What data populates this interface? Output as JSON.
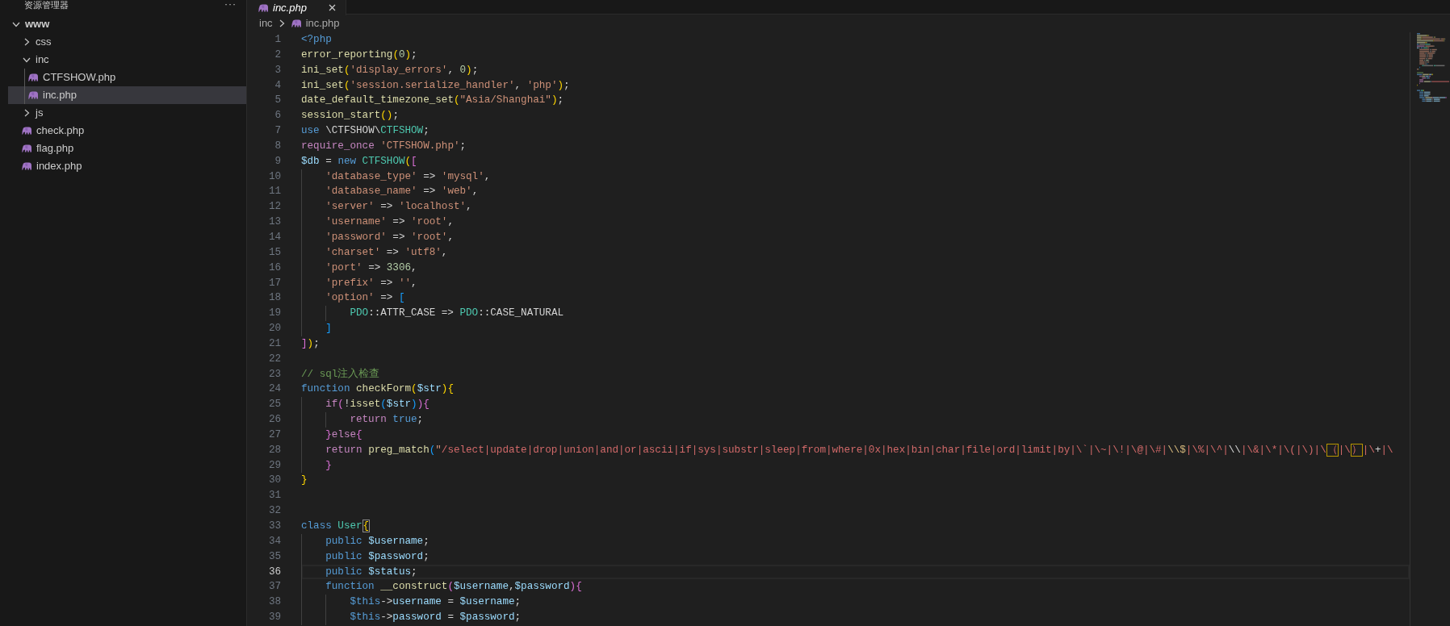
{
  "explorer": {
    "title": "资源管理器",
    "more": "···",
    "tree": [
      {
        "label": "www",
        "kind": "folder",
        "expanded": true,
        "selected": false,
        "children": [
          {
            "label": "css",
            "kind": "folder",
            "expanded": false,
            "selected": false
          },
          {
            "label": "inc",
            "kind": "folder",
            "expanded": true,
            "selected": false,
            "children": [
              {
                "label": "CTFSHOW.php",
                "kind": "php",
                "selected": false
              },
              {
                "label": "inc.php",
                "kind": "php",
                "selected": true
              }
            ]
          },
          {
            "label": "js",
            "kind": "folder",
            "expanded": false,
            "selected": false
          },
          {
            "label": "check.php",
            "kind": "php",
            "selected": false
          },
          {
            "label": "flag.php",
            "kind": "php",
            "selected": false
          },
          {
            "label": "index.php",
            "kind": "php",
            "selected": false
          }
        ]
      }
    ]
  },
  "tabs": [
    {
      "label": "inc.php",
      "kind": "php",
      "selected": true,
      "preview": true
    }
  ],
  "breadcrumb": [
    {
      "label": "inc",
      "kind": "folder"
    },
    {
      "label": "inc.php",
      "kind": "php"
    }
  ],
  "editor": {
    "lines": [
      {
        "number": "1",
        "current": false,
        "tokens": [
          {
            "kind": "keyword",
            "text": "<?php"
          }
        ]
      },
      {
        "number": "2",
        "current": false,
        "tokens": [
          {
            "kind": "function",
            "text": "error_reporting"
          },
          {
            "kind": "bracket1",
            "text": "("
          },
          {
            "kind": "number",
            "text": "0"
          },
          {
            "kind": "bracket1",
            "text": ")"
          },
          {
            "kind": "plain",
            "text": ";"
          }
        ]
      },
      {
        "number": "3",
        "current": false,
        "tokens": [
          {
            "kind": "function",
            "text": "ini_set"
          },
          {
            "kind": "bracket1",
            "text": "("
          },
          {
            "kind": "string",
            "text": "'display_errors'"
          },
          {
            "kind": "plain",
            "text": ", "
          },
          {
            "kind": "number",
            "text": "0"
          },
          {
            "kind": "bracket1",
            "text": ")"
          },
          {
            "kind": "plain",
            "text": ";"
          }
        ]
      },
      {
        "number": "4",
        "current": false,
        "tokens": [
          {
            "kind": "function",
            "text": "ini_set"
          },
          {
            "kind": "bracket1",
            "text": "("
          },
          {
            "kind": "string",
            "text": "'session.serialize_handler'"
          },
          {
            "kind": "plain",
            "text": ", "
          },
          {
            "kind": "string",
            "text": "'php'"
          },
          {
            "kind": "bracket1",
            "text": ")"
          },
          {
            "kind": "plain",
            "text": ";"
          }
        ]
      },
      {
        "number": "5",
        "current": false,
        "tokens": [
          {
            "kind": "function",
            "text": "date_default_timezone_set"
          },
          {
            "kind": "bracket1",
            "text": "("
          },
          {
            "kind": "string",
            "text": "\"Asia/Shanghai\""
          },
          {
            "kind": "bracket1",
            "text": ")"
          },
          {
            "kind": "plain",
            "text": ";"
          }
        ]
      },
      {
        "number": "6",
        "current": false,
        "tokens": [
          {
            "kind": "function",
            "text": "session_start"
          },
          {
            "kind": "bracket1",
            "text": "("
          },
          {
            "kind": "bracket1",
            "text": ")"
          },
          {
            "kind": "plain",
            "text": ";"
          }
        ]
      },
      {
        "number": "7",
        "current": false,
        "tokens": [
          {
            "kind": "keyword",
            "text": "use"
          },
          {
            "kind": "plain",
            "text": " \\CTFSHOW\\"
          },
          {
            "kind": "type",
            "text": "CTFSHOW"
          },
          {
            "kind": "plain",
            "text": ";"
          }
        ]
      },
      {
        "number": "8",
        "current": false,
        "tokens": [
          {
            "kind": "control",
            "text": "require_once "
          },
          {
            "kind": "string",
            "text": "'CTFSHOW.php'"
          },
          {
            "kind": "plain",
            "text": ";"
          }
        ]
      },
      {
        "number": "9",
        "current": false,
        "tokens": [
          {
            "kind": "variable",
            "text": "$db"
          },
          {
            "kind": "plain",
            "text": " = "
          },
          {
            "kind": "keyword",
            "text": "new "
          },
          {
            "kind": "type",
            "text": "CTFSHOW"
          },
          {
            "kind": "bracket1",
            "text": "("
          },
          {
            "kind": "bracket2",
            "text": "["
          }
        ]
      },
      {
        "number": "10",
        "current": false,
        "tokens": [
          {
            "kind": "string",
            "text": "    'database_type'"
          },
          {
            "kind": "plain",
            "text": " => "
          },
          {
            "kind": "string",
            "text": "'mysql'"
          },
          {
            "kind": "plain",
            "text": ","
          }
        ]
      },
      {
        "number": "11",
        "current": false,
        "tokens": [
          {
            "kind": "string",
            "text": "    'database_name'"
          },
          {
            "kind": "plain",
            "text": " => "
          },
          {
            "kind": "string",
            "text": "'web'"
          },
          {
            "kind": "plain",
            "text": ","
          }
        ]
      },
      {
        "number": "12",
        "current": false,
        "tokens": [
          {
            "kind": "string",
            "text": "    'server'"
          },
          {
            "kind": "plain",
            "text": " => "
          },
          {
            "kind": "string",
            "text": "'localhost'"
          },
          {
            "kind": "plain",
            "text": ","
          }
        ]
      },
      {
        "number": "13",
        "current": false,
        "tokens": [
          {
            "kind": "string",
            "text": "    'username'"
          },
          {
            "kind": "plain",
            "text": " => "
          },
          {
            "kind": "string",
            "text": "'root'"
          },
          {
            "kind": "plain",
            "text": ","
          }
        ]
      },
      {
        "number": "14",
        "current": false,
        "tokens": [
          {
            "kind": "string",
            "text": "    'password'"
          },
          {
            "kind": "plain",
            "text": " => "
          },
          {
            "kind": "string",
            "text": "'root'"
          },
          {
            "kind": "plain",
            "text": ","
          }
        ]
      },
      {
        "number": "15",
        "current": false,
        "tokens": [
          {
            "kind": "string",
            "text": "    'charset'"
          },
          {
            "kind": "plain",
            "text": " => "
          },
          {
            "kind": "string",
            "text": "'utf8'"
          },
          {
            "kind": "plain",
            "text": ","
          }
        ]
      },
      {
        "number": "16",
        "current": false,
        "tokens": [
          {
            "kind": "string",
            "text": "    'port'"
          },
          {
            "kind": "plain",
            "text": " => "
          },
          {
            "kind": "number",
            "text": "3306"
          },
          {
            "kind": "plain",
            "text": ","
          }
        ]
      },
      {
        "number": "17",
        "current": false,
        "tokens": [
          {
            "kind": "string",
            "text": "    'prefix'"
          },
          {
            "kind": "plain",
            "text": " => "
          },
          {
            "kind": "string",
            "text": "''"
          },
          {
            "kind": "plain",
            "text": ","
          }
        ]
      },
      {
        "number": "18",
        "current": false,
        "tokens": [
          {
            "kind": "string",
            "text": "    'option'"
          },
          {
            "kind": "plain",
            "text": " => "
          },
          {
            "kind": "bracket3",
            "text": "["
          }
        ]
      },
      {
        "number": "19",
        "current": false,
        "tokens": [
          {
            "kind": "type",
            "text": "        PDO"
          },
          {
            "kind": "plain",
            "text": "::ATTR_CASE => "
          },
          {
            "kind": "type",
            "text": "PDO"
          },
          {
            "kind": "plain",
            "text": "::CASE_NATURAL"
          }
        ]
      },
      {
        "number": "20",
        "current": false,
        "tokens": [
          {
            "kind": "bracket3",
            "text": "    ]"
          }
        ]
      },
      {
        "number": "21",
        "current": false,
        "tokens": [
          {
            "kind": "bracket2",
            "text": "]"
          },
          {
            "kind": "bracket1",
            "text": ")"
          },
          {
            "kind": "plain",
            "text": ";"
          }
        ]
      },
      {
        "number": "22",
        "current": false
      },
      {
        "number": "23",
        "current": false,
        "tokens": [
          {
            "kind": "comment",
            "text": "// sql注入检查"
          }
        ]
      },
      {
        "number": "24",
        "current": false,
        "tokens": [
          {
            "kind": "keyword",
            "text": "function "
          },
          {
            "kind": "function",
            "text": "checkForm"
          },
          {
            "kind": "bracket1",
            "text": "("
          },
          {
            "kind": "variable",
            "text": "$str"
          },
          {
            "kind": "bracket1",
            "text": ")"
          },
          {
            "kind": "bracket1",
            "text": "{"
          }
        ]
      },
      {
        "number": "25",
        "current": false,
        "tokens": [
          {
            "kind": "control",
            "text": "    if"
          },
          {
            "kind": "bracket2",
            "text": "("
          },
          {
            "kind": "plain",
            "text": "!"
          },
          {
            "kind": "function",
            "text": "isset"
          },
          {
            "kind": "bracket3",
            "text": "("
          },
          {
            "kind": "variable",
            "text": "$str"
          },
          {
            "kind": "bracket3",
            "text": ")"
          },
          {
            "kind": "bracket2",
            "text": ")"
          },
          {
            "kind": "bracket2",
            "text": "{"
          }
        ]
      },
      {
        "number": "26",
        "current": false,
        "tokens": [
          {
            "kind": "control",
            "text": "        return "
          },
          {
            "kind": "keyword",
            "text": "true"
          },
          {
            "kind": "plain",
            "text": ";"
          }
        ]
      },
      {
        "number": "27",
        "current": false,
        "tokens": [
          {
            "kind": "bracket2",
            "text": "    }"
          },
          {
            "kind": "control",
            "text": "else"
          },
          {
            "kind": "bracket2",
            "text": "{"
          }
        ]
      },
      {
        "number": "28",
        "current": false,
        "tokens": [
          {
            "kind": "control",
            "text": "    return "
          },
          {
            "kind": "function",
            "text": "preg_match"
          },
          {
            "kind": "bracket3",
            "text": "("
          },
          {
            "kind": "string",
            "text": "\""
          },
          {
            "kind": "regex",
            "text": "/select|update|drop|union|and|or|ascii|if|sys|substr|sleep|from|where|0x|hex|bin|char|file|ord|limit|by|\\`|\\~|\\!|\\@|\\#|"
          },
          {
            "kind": "escape",
            "text": "\\\\$"
          },
          {
            "kind": "regex",
            "text": "|\\%|\\^|"
          },
          {
            "kind": "plain",
            "text": "\\\\"
          },
          {
            "kind": "regex",
            "text": "|\\&|\\*|\\(|\\)|\\"
          },
          {
            "kind": "flagged",
            "text": "（"
          },
          {
            "kind": "regex",
            "text": "|\\"
          },
          {
            "kind": "flagged",
            "text": "）"
          },
          {
            "kind": "regex",
            "text": "|\\"
          },
          {
            "kind": "plain",
            "text": "+"
          },
          {
            "kind": "regex",
            "text": "|\\"
          }
        ]
      },
      {
        "number": "29",
        "current": false,
        "tokens": [
          {
            "kind": "bracket2",
            "text": "    }"
          }
        ]
      },
      {
        "number": "30",
        "current": false,
        "tokens": [
          {
            "kind": "bracket1",
            "text": "}"
          }
        ]
      },
      {
        "number": "31",
        "current": false
      },
      {
        "number": "32",
        "current": false
      },
      {
        "number": "33",
        "current": false,
        "tokens": [
          {
            "kind": "keyword",
            "text": "class "
          },
          {
            "kind": "type",
            "text": "User"
          },
          {
            "kind": "matched",
            "text": "{"
          }
        ]
      },
      {
        "number": "34",
        "current": false,
        "tokens": [
          {
            "kind": "keyword",
            "text": "    public "
          },
          {
            "kind": "variable",
            "text": "$username"
          },
          {
            "kind": "plain",
            "text": ";"
          }
        ]
      },
      {
        "number": "35",
        "current": false,
        "tokens": [
          {
            "kind": "keyword",
            "text": "    public "
          },
          {
            "kind": "variable",
            "text": "$password"
          },
          {
            "kind": "plain",
            "text": ";"
          }
        ]
      },
      {
        "number": "36",
        "current": true,
        "tokens": [
          {
            "kind": "keyword",
            "text": "    public "
          },
          {
            "kind": "variable",
            "text": "$status"
          },
          {
            "kind": "plain",
            "text": ";"
          }
        ]
      },
      {
        "number": "37",
        "current": false,
        "tokens": [
          {
            "kind": "keyword",
            "text": "    function "
          },
          {
            "kind": "function",
            "text": "__construct"
          },
          {
            "kind": "bracket2",
            "text": "("
          },
          {
            "kind": "variable",
            "text": "$username"
          },
          {
            "kind": "plain",
            "text": ","
          },
          {
            "kind": "variable",
            "text": "$password"
          },
          {
            "kind": "bracket2",
            "text": ")"
          },
          {
            "kind": "bracket2",
            "text": "{"
          }
        ]
      },
      {
        "number": "38",
        "current": false,
        "tokens": [
          {
            "kind": "keyword",
            "text": "        $this"
          },
          {
            "kind": "plain",
            "text": "->"
          },
          {
            "kind": "variable",
            "text": "username"
          },
          {
            "kind": "plain",
            "text": " = "
          },
          {
            "kind": "variable",
            "text": "$username"
          },
          {
            "kind": "plain",
            "text": ";"
          }
        ]
      },
      {
        "number": "39",
        "current": false,
        "tokens": [
          {
            "kind": "keyword",
            "text": "        $this"
          },
          {
            "kind": "plain",
            "text": "->"
          },
          {
            "kind": "variable",
            "text": "password"
          },
          {
            "kind": "plain",
            "text": " = "
          },
          {
            "kind": "variable",
            "text": "$password"
          },
          {
            "kind": "plain",
            "text": ";"
          }
        ]
      }
    ]
  }
}
